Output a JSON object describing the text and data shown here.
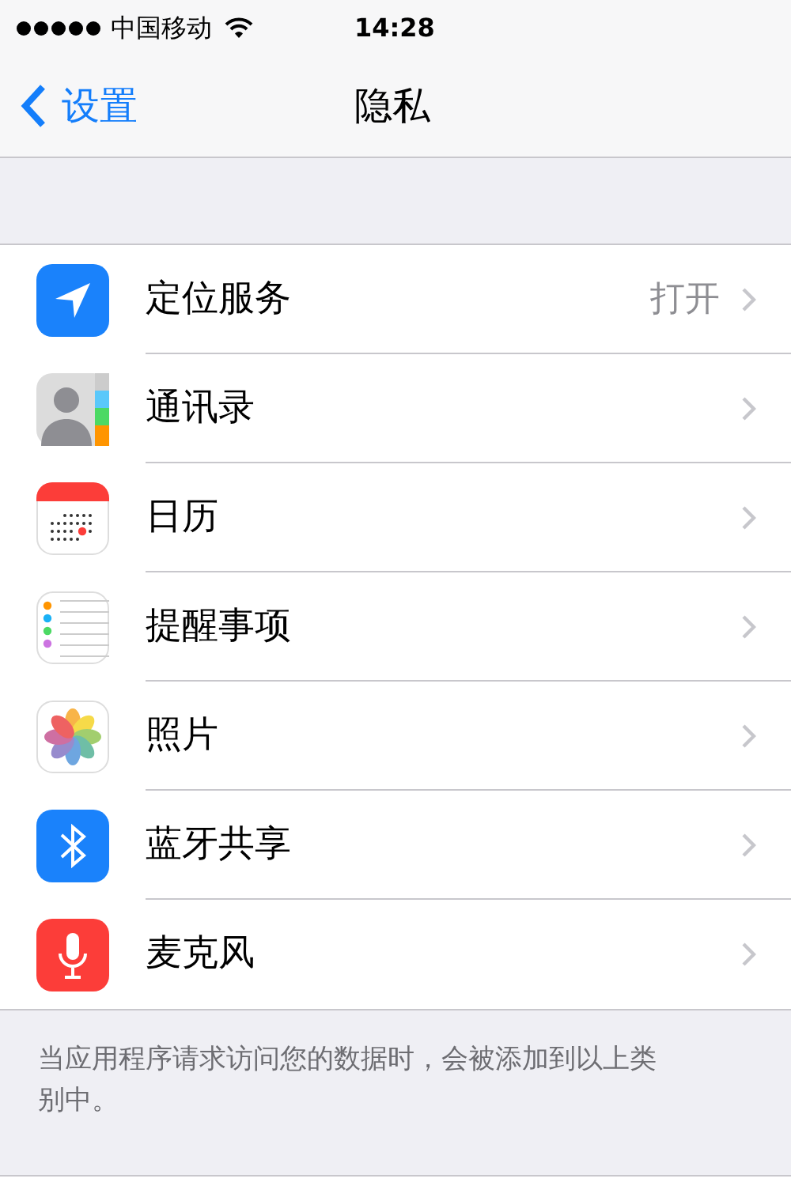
{
  "status_bar": {
    "carrier": "中国移动",
    "time": "14:28"
  },
  "nav": {
    "back": "设置",
    "title": "隐私"
  },
  "items": [
    {
      "kind": "location",
      "label": "定位服务",
      "value": "打开"
    },
    {
      "kind": "contacts",
      "label": "通讯录"
    },
    {
      "kind": "calendar",
      "label": "日历"
    },
    {
      "kind": "reminders",
      "label": "提醒事项"
    },
    {
      "kind": "photos",
      "label": "照片"
    },
    {
      "kind": "bluetooth",
      "label": "蓝牙共享"
    },
    {
      "kind": "microphone",
      "label": "麦克风"
    }
  ],
  "footer": "当应用程序请求访问您的数据时，会被添加到以上类别中。"
}
